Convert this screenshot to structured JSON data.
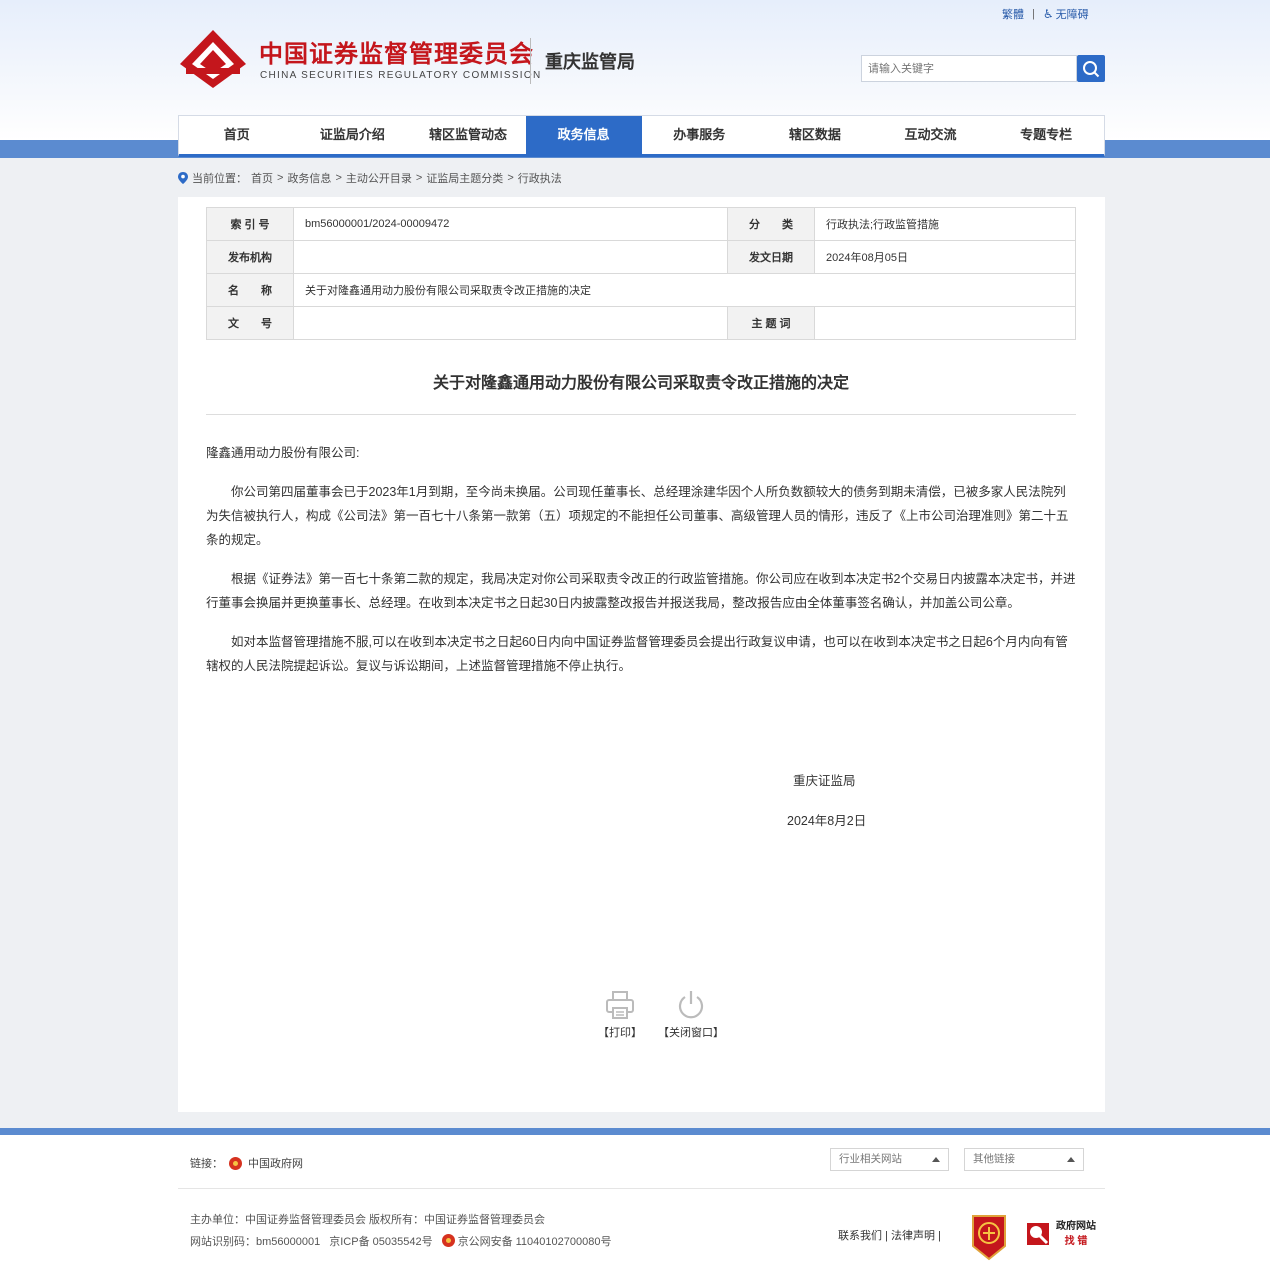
{
  "header": {
    "top_links": {
      "traditional": "繁體",
      "accessibility": "无障碍"
    },
    "brand_cn": "中国证券监督管理委员会",
    "brand_en": "CHINA SECURITIES REGULATORY COMMISSION",
    "bureau": "重庆监管局",
    "search_placeholder": "请输入关键字"
  },
  "nav": {
    "items": [
      "首页",
      "证监局介绍",
      "辖区监管动态",
      "政务信息",
      "办事服务",
      "辖区数据",
      "互动交流",
      "专题专栏"
    ],
    "active": "政务信息"
  },
  "breadcrumb": {
    "label": "当前位置：",
    "items": [
      "首页",
      "政务信息",
      "主动公开目录",
      "证监局主题分类",
      "行政执法"
    ],
    "sep": ">"
  },
  "meta": {
    "index_label": "索 引 号",
    "index_value": "bm56000001/2024-00009472",
    "category_label": "分　　类",
    "category_value": "行政执法;行政监管措施",
    "publisher_label": "发布机构",
    "publisher_value": "",
    "date_label": "发文日期",
    "date_value": "2024年08月05日",
    "name_label": "名　　称",
    "name_value": "关于对隆鑫通用动力股份有限公司采取责令改正措施的决定",
    "docno_label": "文　　号",
    "docno_value": "",
    "keyword_label": "主 题 词",
    "keyword_value": ""
  },
  "document": {
    "title": "关于对隆鑫通用动力股份有限公司采取责令改正措施的决定",
    "salutation": "隆鑫通用动力股份有限公司:",
    "paragraphs": [
      "你公司第四届董事会已于2023年1月到期，至今尚未换届。公司现任董事长、总经理涂建华因个人所负数额较大的债务到期未清偿，已被多家人民法院列为失信被执行人，构成《公司法》第一百七十八条第一款第（五）项规定的不能担任公司董事、高级管理人员的情形，违反了《上市公司治理准则》第二十五条的规定。",
      "根据《证券法》第一百七十条第二款的规定，我局决定对你公司采取责令改正的行政监管措施。你公司应在收到本决定书2个交易日内披露本决定书，并进行董事会换届并更换董事长、总经理。在收到本决定书之日起30日内披露整改报告并报送我局，整改报告应由全体董事签名确认，并加盖公司公章。",
      "如对本监督管理措施不服,可以在收到本决定书之日起60日内向中国证券监督管理委员会提出行政复议申请，也可以在收到本决定书之日起6个月内向有管辖权的人民法院提起诉讼。复议与诉讼期间，上述监督管理措施不停止执行。"
    ],
    "signer": "重庆证监局",
    "sign_date": "2024年8月2日"
  },
  "tools": {
    "print": "【打印】",
    "close": "【关闭窗口】"
  },
  "footer": {
    "links_label": "链接：",
    "gov_link": "中国政府网",
    "select1": "行业相关网站",
    "select2": "其他链接",
    "sponsor": "主办单位：中国证券监督管理委员会  版权所有：中国证券监督管理委员会",
    "site_id": "网站识别码：bm56000001",
    "icp": "京ICP备 05035542号",
    "police": "京公网安备 11040102700080号",
    "right_links": "联系我们 | 法律声明 |",
    "badge_text1": "政府网站",
    "badge_text2": "找 错"
  },
  "colors": {
    "brand_red": "#c4161c",
    "nav_blue": "#2d6bc7",
    "band_blue": "#5b8bd0"
  }
}
